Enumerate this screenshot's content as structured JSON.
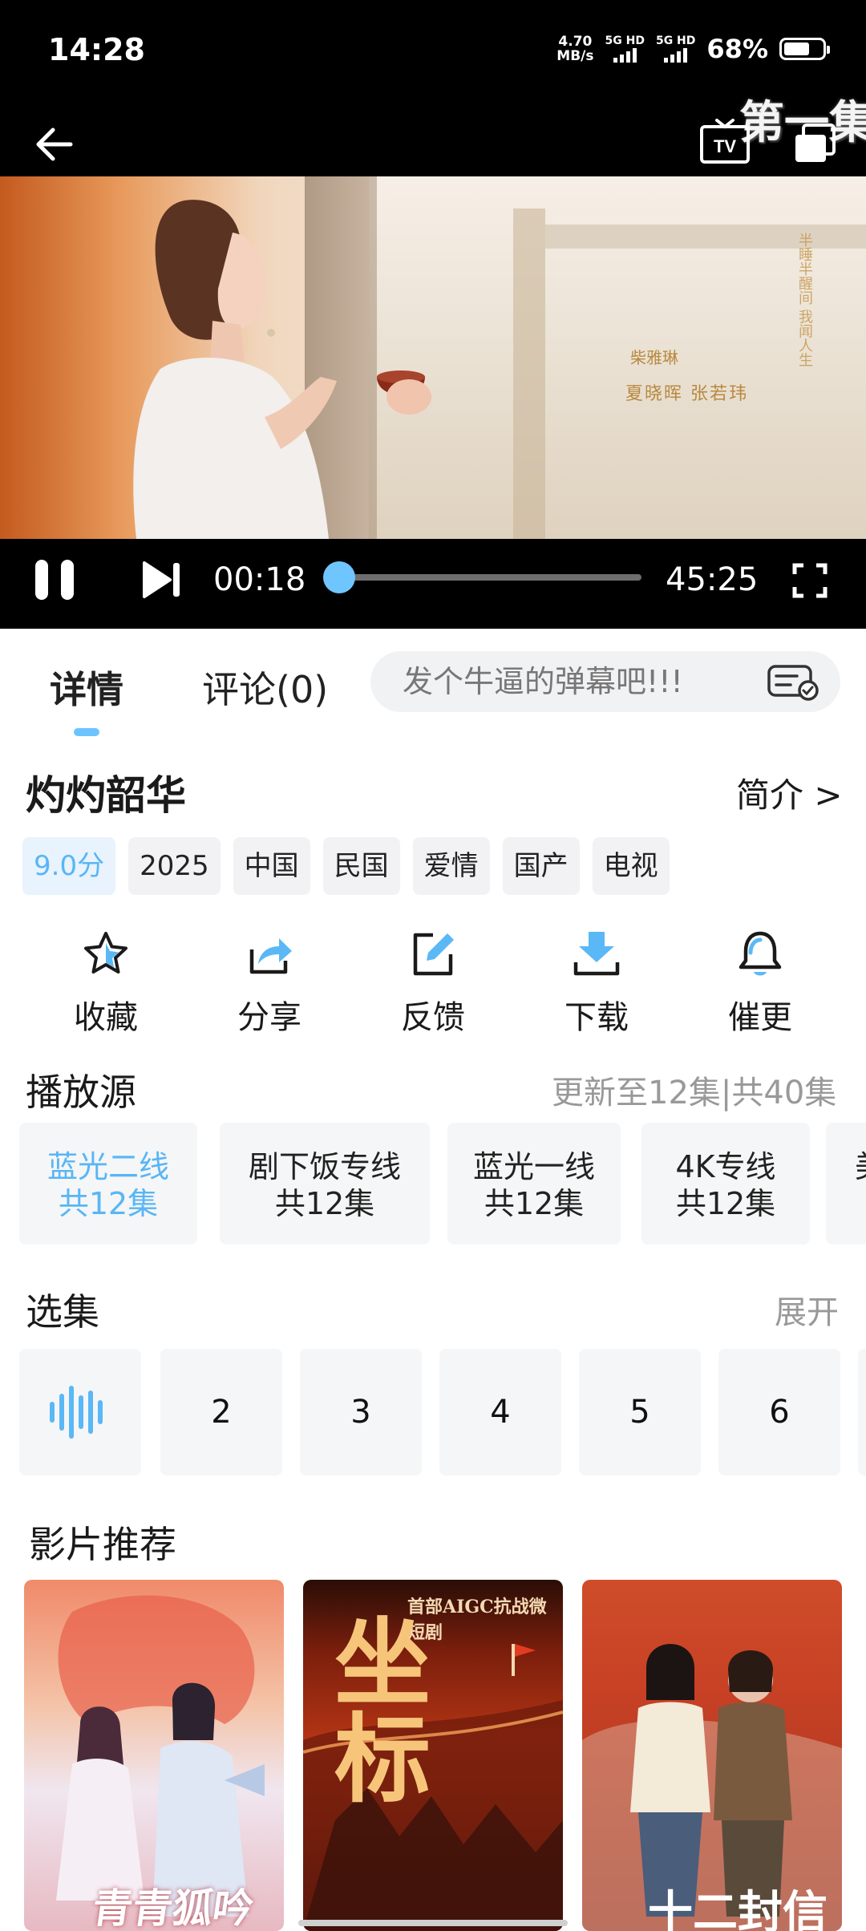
{
  "status_bar": {
    "time": "14:28",
    "net_speed_value": "4.70",
    "net_speed_unit": "MB/s",
    "sim1_label": "5G HD",
    "sim2_label": "5G HD",
    "battery_percent": "68%",
    "battery_level": 0.68
  },
  "player": {
    "episode_overlay": "第一集",
    "current_time": "00:18",
    "total_time": "45:25",
    "progress": 0.0066,
    "video_credits": {
      "line1": "柴雅琳",
      "line2": "夏晓晖  张若玮",
      "vertical": "半睡半醒间 我闻人生"
    }
  },
  "tabs": {
    "details_label": "详情",
    "comments_label": "评论(0)",
    "danmu_placeholder": "发个牛逼的弹幕吧!!!"
  },
  "show": {
    "title": "灼灼韶华",
    "intro_link": "简介 >",
    "tags": [
      "9.0分",
      "2025",
      "中国",
      "民国",
      "爱情",
      "国产",
      "电视"
    ]
  },
  "actions": {
    "favorite": "收藏",
    "share": "分享",
    "feedback": "反馈",
    "download": "下载",
    "remind": "催更"
  },
  "sources": {
    "title": "播放源",
    "update_info": "更新至12集|共40集",
    "items": [
      {
        "name": "蓝光二线",
        "count": "共12集"
      },
      {
        "name": "剧下饭专线",
        "count": "共12集"
      },
      {
        "name": "蓝光一线",
        "count": "共12集"
      },
      {
        "name": "4K专线",
        "count": "共12集"
      },
      {
        "name": "美",
        "count": ""
      }
    ]
  },
  "episodes": {
    "title": "选集",
    "expand": "展开",
    "items": [
      "2",
      "3",
      "4",
      "5",
      "6"
    ]
  },
  "recommendations": {
    "title": "影片推荐",
    "items": [
      {
        "title": "青青狐吟"
      },
      {
        "tagline": "首部AIGC抗战微短剧",
        "title": "坐标"
      },
      {
        "title": "十二封信"
      }
    ]
  },
  "colors": {
    "accent": "#6cc4ff",
    "accent_text": "#58b6f5",
    "chip_bg": "#f2f2f4",
    "muted_text": "#999999"
  },
  "icons": {
    "back": "arrow-left-icon",
    "tv": "tv-cast-icon",
    "pip": "picture-in-picture-icon",
    "pause": "pause-icon",
    "next": "skip-next-icon",
    "fullscreen": "fullscreen-icon",
    "danmu": "danmu-settings-icon",
    "favorite": "star-icon",
    "share": "share-icon",
    "feedback": "edit-icon",
    "download": "download-icon",
    "remind": "bell-icon",
    "playing": "sound-wave-icon"
  }
}
